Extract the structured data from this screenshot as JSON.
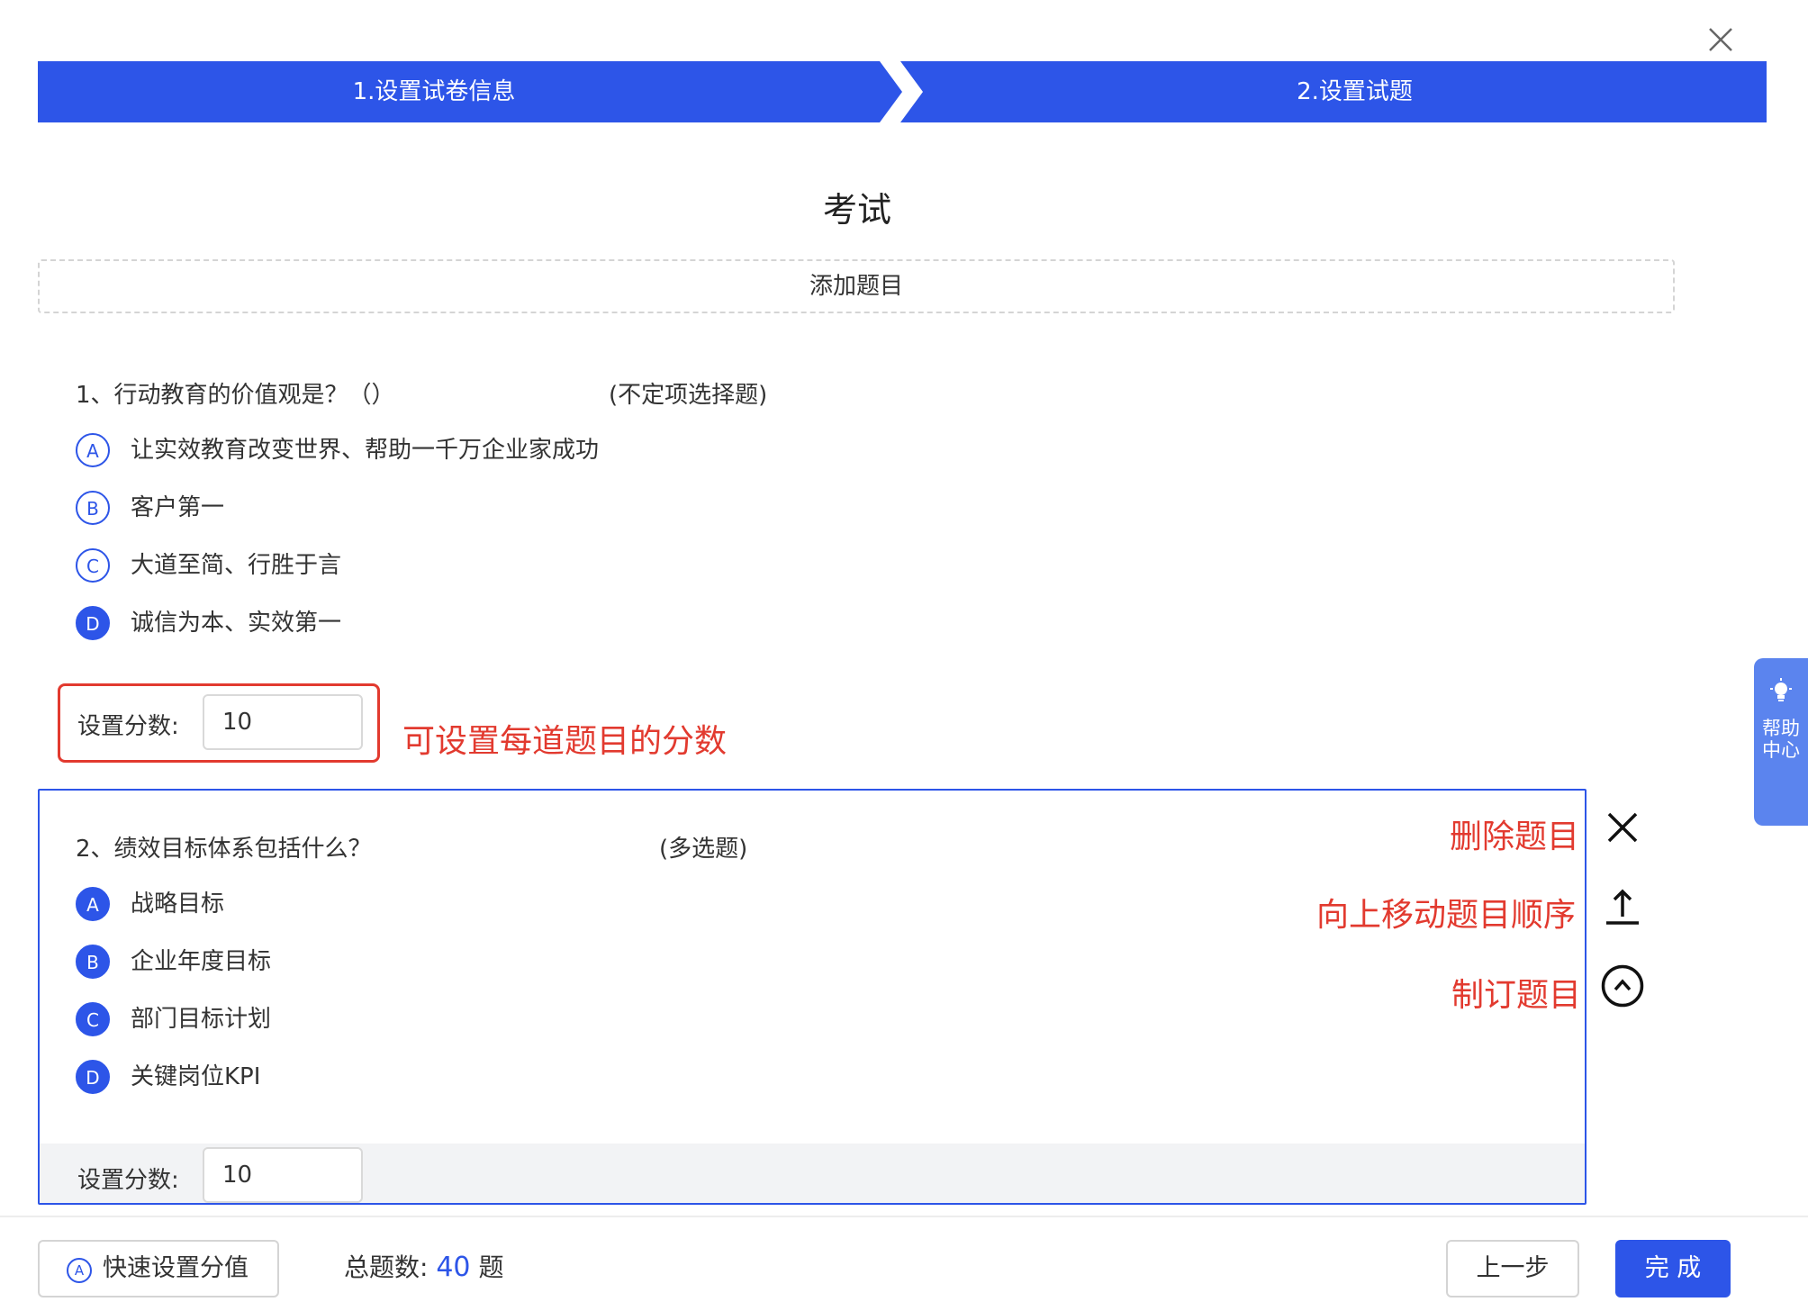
{
  "steps": [
    {
      "label": "1.设置试卷信息"
    },
    {
      "label": "2.设置试题"
    }
  ],
  "exam": {
    "title": "考试"
  },
  "add_question": {
    "label": "添加题目"
  },
  "questions": [
    {
      "stem": "1、行动教育的价值观是？（）",
      "type": "(不定项选择题)",
      "options": [
        {
          "letter": "A",
          "text": "让实效教育改变世界、帮助一千万企业家成功"
        },
        {
          "letter": "B",
          "text": "客户第一"
        },
        {
          "letter": "C",
          "text": "大道至简、行胜于言"
        },
        {
          "letter": "D",
          "text": "诚信为本、实效第一"
        }
      ],
      "score_label": "设置分数:",
      "score_value": "10"
    },
    {
      "stem": "2、绩效目标体系包括什么？",
      "type": "(多选题)",
      "options": [
        {
          "letter": "A",
          "text": "战略目标"
        },
        {
          "letter": "B",
          "text": "企业年度目标"
        },
        {
          "letter": "C",
          "text": "部门目标计划"
        },
        {
          "letter": "D",
          "text": "关键岗位KPI"
        }
      ],
      "score_label": "设置分数:",
      "score_value": "10"
    }
  ],
  "annotations": {
    "score": "可设置每道题目的分数",
    "delete": "删除题目",
    "move_up": "向上移动题目顺序",
    "edit": "制订题目"
  },
  "tools": {
    "delete_icon": "close-icon",
    "move_up_icon": "arrow-up-icon",
    "edit_icon": "chevron-up-circle-icon"
  },
  "help_tab": {
    "label": "帮助中心",
    "icon": "lightbulb-icon"
  },
  "footer": {
    "quick_set_label": "快速设置分值",
    "quick_set_icon_letter": "A",
    "total_label": "总题数:",
    "total_count": "40",
    "total_unit": "题",
    "prev_label": "上一步",
    "done_label": "完 成"
  },
  "colors": {
    "primary": "#2d55e8",
    "annotation_red": "#e23a2f",
    "help_tab": "#5b84ee"
  }
}
